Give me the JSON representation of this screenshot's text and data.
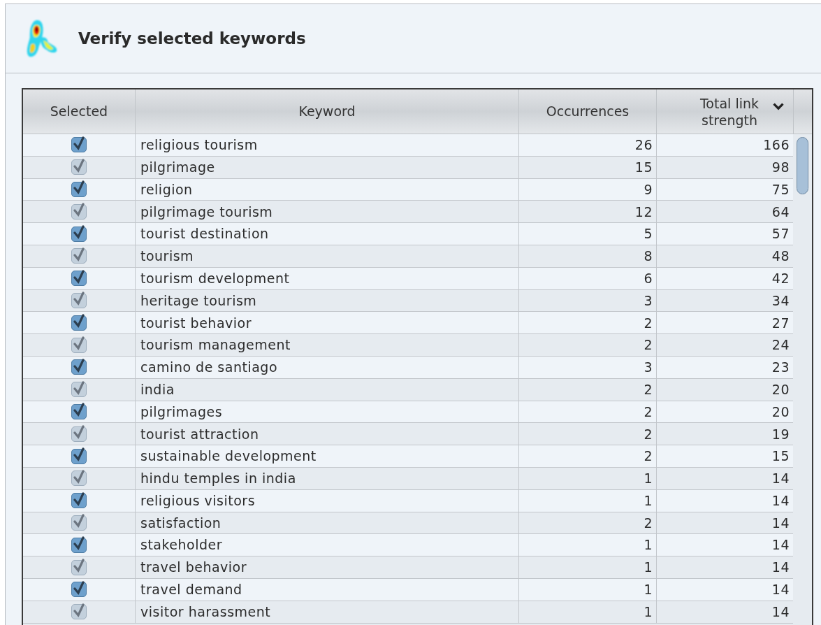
{
  "title": "Verify selected keywords",
  "table": {
    "columns": [
      {
        "label": "Selected",
        "sorted": false
      },
      {
        "label": "Keyword",
        "sorted": false
      },
      {
        "label": "Occurrences",
        "sorted": false
      },
      {
        "label": "Total link strength",
        "sorted": true
      }
    ],
    "rows": [
      {
        "checked": true,
        "keyword": "religious tourism",
        "occurrences": "26",
        "strength": "166"
      },
      {
        "checked": true,
        "keyword": "pilgrimage",
        "occurrences": "15",
        "strength": "98"
      },
      {
        "checked": true,
        "keyword": "religion",
        "occurrences": "9",
        "strength": "75"
      },
      {
        "checked": true,
        "keyword": "pilgrimage tourism",
        "occurrences": "12",
        "strength": "64"
      },
      {
        "checked": true,
        "keyword": "tourist destination",
        "occurrences": "5",
        "strength": "57"
      },
      {
        "checked": true,
        "keyword": "tourism",
        "occurrences": "8",
        "strength": "48"
      },
      {
        "checked": true,
        "keyword": "tourism development",
        "occurrences": "6",
        "strength": "42"
      },
      {
        "checked": true,
        "keyword": "heritage tourism",
        "occurrences": "3",
        "strength": "34"
      },
      {
        "checked": true,
        "keyword": "tourist behavior",
        "occurrences": "2",
        "strength": "27"
      },
      {
        "checked": true,
        "keyword": "tourism management",
        "occurrences": "2",
        "strength": "24"
      },
      {
        "checked": true,
        "keyword": "camino de santiago",
        "occurrences": "3",
        "strength": "23"
      },
      {
        "checked": true,
        "keyword": "india",
        "occurrences": "2",
        "strength": "20"
      },
      {
        "checked": true,
        "keyword": "pilgrimages",
        "occurrences": "2",
        "strength": "20"
      },
      {
        "checked": true,
        "keyword": "tourist attraction",
        "occurrences": "2",
        "strength": "19"
      },
      {
        "checked": true,
        "keyword": "sustainable development",
        "occurrences": "2",
        "strength": "15"
      },
      {
        "checked": true,
        "keyword": "hindu temples in india",
        "occurrences": "1",
        "strength": "14"
      },
      {
        "checked": true,
        "keyword": "religious visitors",
        "occurrences": "1",
        "strength": "14"
      },
      {
        "checked": true,
        "keyword": "satisfaction",
        "occurrences": "2",
        "strength": "14"
      },
      {
        "checked": true,
        "keyword": "stakeholder",
        "occurrences": "1",
        "strength": "14"
      },
      {
        "checked": true,
        "keyword": "travel behavior",
        "occurrences": "1",
        "strength": "14"
      },
      {
        "checked": true,
        "keyword": "travel demand",
        "occurrences": "1",
        "strength": "14"
      },
      {
        "checked": true,
        "keyword": "visitor harassment",
        "occurrences": "1",
        "strength": "14"
      }
    ]
  }
}
